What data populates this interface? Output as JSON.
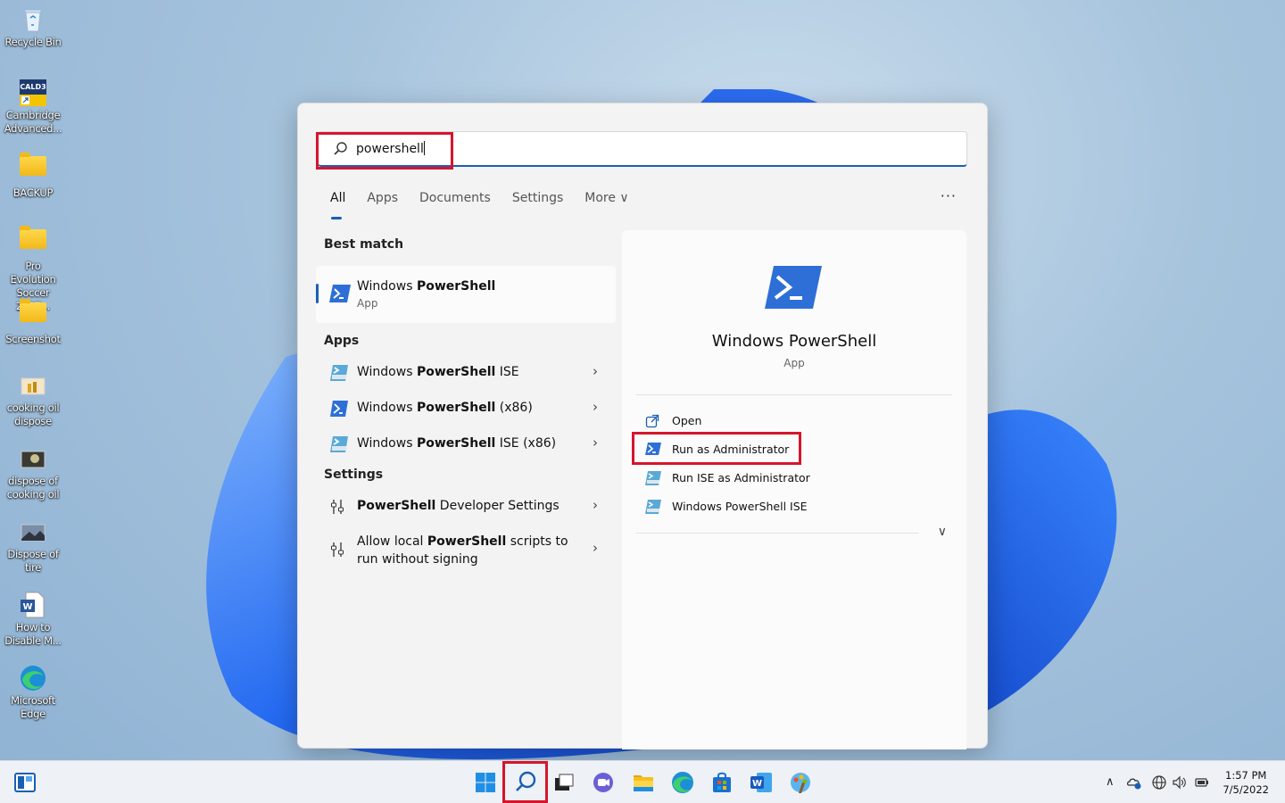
{
  "desktop": {
    "icons": [
      {
        "label": "Recycle Bin",
        "icon": "recycle-bin-icon"
      },
      {
        "label": "Cambridge Advanced...",
        "icon": "cambridge-app-icon",
        "badge": "CALD3"
      },
      {
        "label": "BACKUP",
        "icon": "folder-icon"
      },
      {
        "label": "Pro Evolution Soccer 2017...",
        "icon": "folder-icon"
      },
      {
        "label": "Screenshot",
        "icon": "folder-icon"
      },
      {
        "label": "cooking oil dispose",
        "icon": "image-icon"
      },
      {
        "label": "dispose of cooking oil",
        "icon": "image-icon"
      },
      {
        "label": "Dispose of tire",
        "icon": "image-icon"
      },
      {
        "label": "How to Disable M...",
        "icon": "word-doc-icon"
      },
      {
        "label": "Microsoft Edge",
        "icon": "edge-icon"
      }
    ]
  },
  "search": {
    "query": "powershell",
    "tabs": [
      "All",
      "Apps",
      "Documents",
      "Settings",
      "More ∨"
    ],
    "active_tab": "All",
    "more_options": "···"
  },
  "results": {
    "best_match_header": "Best match",
    "best_match": {
      "name_pre": "Windows ",
      "name_bold": "PowerShell",
      "type": "App"
    },
    "apps_header": "Apps",
    "apps": [
      {
        "pre": "Windows ",
        "bold": "PowerShell",
        "post": " ISE"
      },
      {
        "pre": "Windows ",
        "bold": "PowerShell",
        "post": " (x86)"
      },
      {
        "pre": "Windows ",
        "bold": "PowerShell",
        "post": " ISE (x86)"
      }
    ],
    "settings_header": "Settings",
    "settings": [
      {
        "pre": "",
        "bold": "PowerShell",
        "post": " Developer Settings",
        "line2": ""
      },
      {
        "pre": "Allow local ",
        "bold": "PowerShell",
        "post": " scripts to",
        "line2": "run without signing"
      }
    ]
  },
  "preview": {
    "title": "Windows PowerShell",
    "subtitle": "App",
    "actions": [
      {
        "label": "Open",
        "icon": "open-external-icon"
      },
      {
        "label": "Run as Administrator",
        "icon": "powershell-icon"
      },
      {
        "label": "Run ISE as Administrator",
        "icon": "powershell-ise-icon"
      },
      {
        "label": "Windows PowerShell ISE",
        "icon": "powershell-ise-icon"
      }
    ]
  },
  "taskbar": {
    "clock_time": "1:57 PM",
    "clock_date": "7/5/2022",
    "pinned": [
      "start-icon",
      "search-icon",
      "task-view-icon",
      "chat-icon",
      "file-explorer-icon",
      "edge-icon",
      "store-icon",
      "word-icon",
      "paint-icon"
    ]
  },
  "colors": {
    "accent": "#1a5fb4",
    "highlight_box": "#d6152c",
    "powershell_blue": "#2d6fd6"
  }
}
